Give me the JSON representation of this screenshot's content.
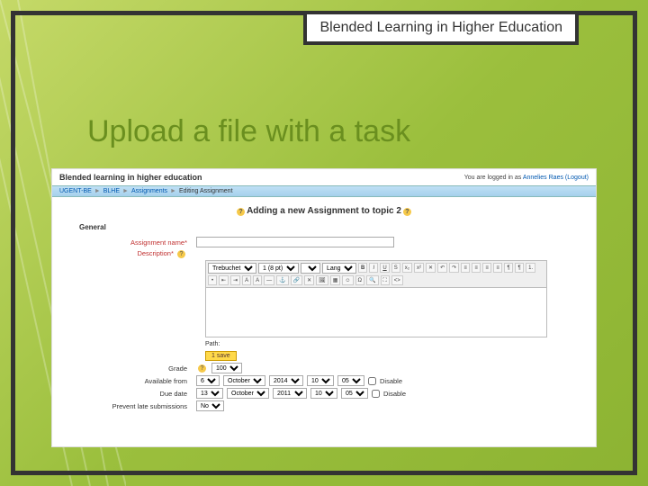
{
  "slide": {
    "title_box": "Blended Learning in Higher Education",
    "heading": "Upload a file with a task"
  },
  "shot": {
    "header_title": "Blended learning in higher education",
    "login_prefix": "You are logged in as ",
    "login_user": "Annelies Raes",
    "login_suffix": " (Logout)",
    "breadcrumb": {
      "items": [
        "UGENT-BE",
        "BLHE",
        "Assignments",
        "Editing Assignment"
      ]
    },
    "form_title": "Adding a new Assignment to topic 2",
    "fieldset_general": "General",
    "labels": {
      "assignment_name": "Assignment name*",
      "description": "Description*",
      "path": "Path:",
      "save_btn": "1 save",
      "grade": "Grade",
      "available_from": "Available from",
      "due_date": "Due date",
      "prevent_late": "Prevent late submissions",
      "disable": "Disable"
    },
    "editor_toolbar": {
      "font_family": "Trebuchet",
      "font_size": "1 (8 pt)",
      "lang": "Lang"
    },
    "values": {
      "grade": "100",
      "avail_day": "6",
      "avail_month": "October",
      "avail_year": "2014",
      "avail_hour": "10",
      "avail_min": "05",
      "due_day": "13",
      "due_month": "October",
      "due_year": "2011",
      "due_hour": "10",
      "due_min": "05",
      "prevent_late_val": "No"
    }
  }
}
